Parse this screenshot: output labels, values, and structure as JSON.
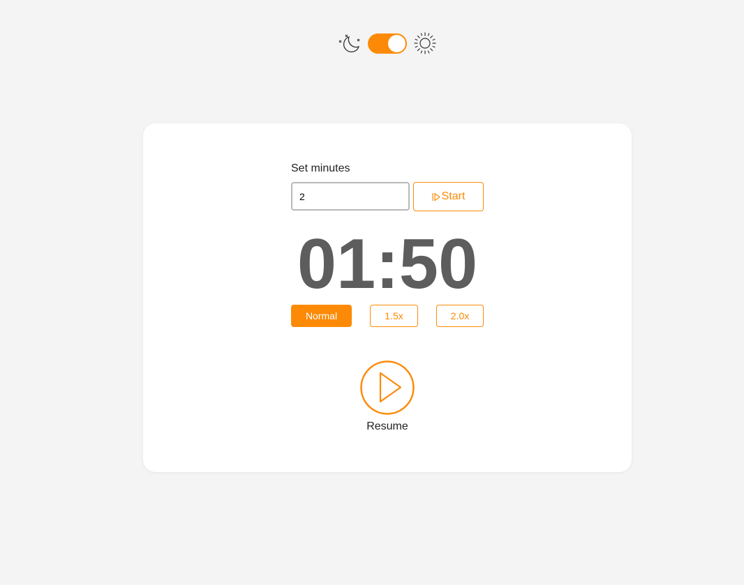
{
  "theme": {
    "dark_icon": "moon-stars-icon",
    "light_icon": "sun-icon",
    "mode": "light",
    "accent_color": "#fd8a06"
  },
  "timer": {
    "set_label": "Set minutes",
    "minutes_value": "2",
    "start_label": "Start",
    "start_icon": "play-outline-icon",
    "display": "01:50",
    "speeds": [
      {
        "label": "Normal",
        "active": true
      },
      {
        "label": "1.5x",
        "active": false
      },
      {
        "label": "2.0x",
        "active": false
      }
    ],
    "play_icon": "play-circle-icon",
    "resume_label": "Resume"
  }
}
